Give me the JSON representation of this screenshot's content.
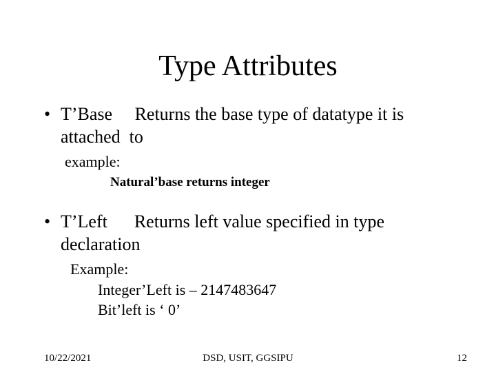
{
  "title": "Type Attributes",
  "bullets": [
    {
      "text": "T’Base     Returns the base type of datatype it is attached  to",
      "sub1": "example:",
      "sub2": "Natural’base returns integer"
    },
    {
      "text": "T’Left      Returns left value specified in type declaration",
      "sub1": "Example:",
      "sub2a": "Integer’Left is – 2147483647",
      "sub2b": "Bit’left is ‘ 0’"
    }
  ],
  "footer": {
    "left": "10/22/2021",
    "center": "DSD, USIT, GGSIPU",
    "right": "12"
  }
}
